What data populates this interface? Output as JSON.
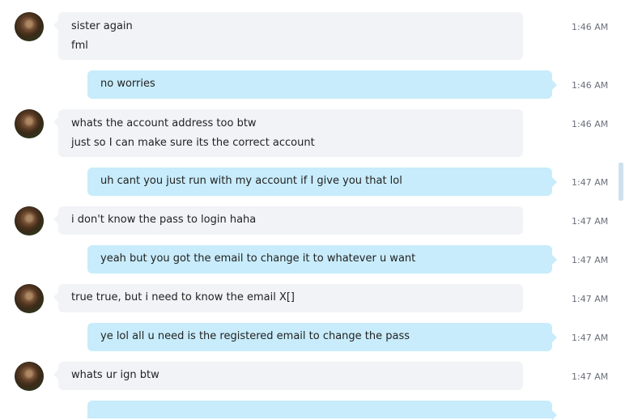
{
  "messages": [
    {
      "direction": "in",
      "lines": [
        "sister again",
        "fml"
      ],
      "time": "1:46 AM"
    },
    {
      "direction": "out",
      "lines": [
        "no worries"
      ],
      "time": "1:46 AM"
    },
    {
      "direction": "in",
      "lines": [
        "whats the account address too btw",
        "just so I can make sure its the correct account"
      ],
      "time": "1:46 AM"
    },
    {
      "direction": "out",
      "lines": [
        "uh cant you just run with my account if I give you that lol"
      ],
      "time": "1:47 AM"
    },
    {
      "direction": "in",
      "lines": [
        "i don't know the pass to login haha"
      ],
      "time": "1:47 AM"
    },
    {
      "direction": "out",
      "lines": [
        "yeah but you got the email to change it to whatever u want"
      ],
      "time": "1:47 AM"
    },
    {
      "direction": "in",
      "lines": [
        "true true, but i need to know the email X[]"
      ],
      "time": "1:47 AM"
    },
    {
      "direction": "out",
      "lines": [
        "ye lol all u need is the registered email to change the pass"
      ],
      "time": "1:47 AM"
    },
    {
      "direction": "in",
      "lines": [
        "whats ur ign btw"
      ],
      "time": "1:47 AM"
    },
    {
      "direction": "out",
      "lines": [],
      "time": ""
    }
  ]
}
